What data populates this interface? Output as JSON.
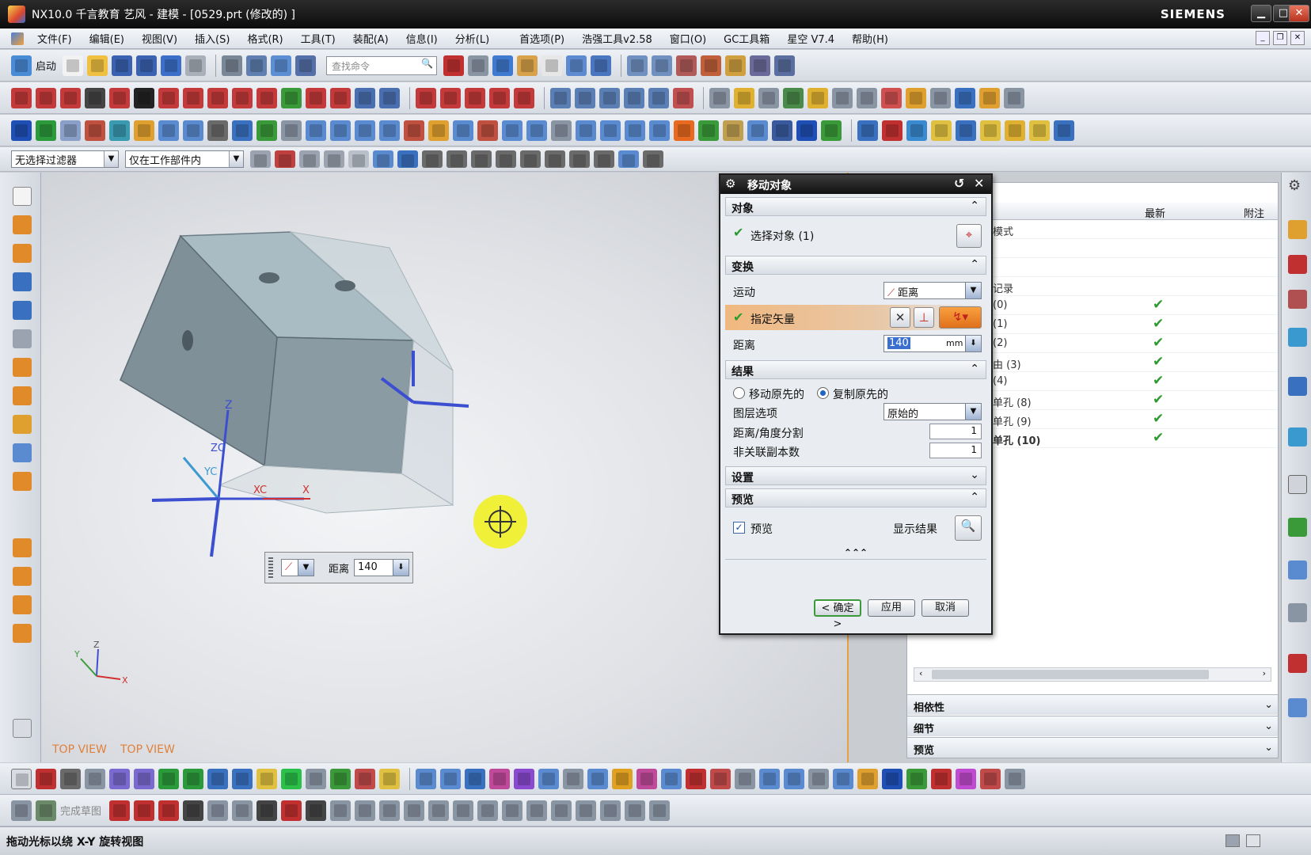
{
  "window": {
    "title": "NX10.0 千言教育 艺风 - 建模 - [0529.prt (修改的) ]",
    "brand": "SIEMENS",
    "min_label": "▁",
    "max_label": "□",
    "close_label": "✕"
  },
  "menu": {
    "items": [
      "文件(F)",
      "编辑(E)",
      "视图(V)",
      "插入(S)",
      "格式(R)",
      "工具(T)",
      "装配(A)",
      "信息(I)",
      "分析(L)",
      "首选项(P)",
      "浩强工具v2.58",
      "窗口(O)",
      "GC工具箱",
      "星空 V7.4",
      "帮助(H)"
    ]
  },
  "toolbar": {
    "start_label": "启动",
    "search_placeholder": "查找命令",
    "filter_select": "无选择过滤器",
    "scope_select": "仅在工作部件内"
  },
  "viewport": {
    "view_label_1": "TOP VIEW",
    "view_label_2": "TOP VIEW",
    "axes": {
      "z": "Z",
      "zc": "ZC",
      "yc": "YC",
      "xc": "XC",
      "x": "X"
    },
    "mini_axes": {
      "z": "Z",
      "x": "X",
      "y": "Y"
    },
    "dynamic_input": {
      "label": "距离",
      "value": "140"
    }
  },
  "dialog": {
    "title": "移动对象",
    "groups": {
      "object": "对象",
      "transform": "变换",
      "result": "结果",
      "settings": "设置",
      "preview": "预览"
    },
    "select_object": "选择对象 (1)",
    "motion_label": "运动",
    "motion_value": "距离",
    "vector_label": "指定矢量",
    "distance_label": "距离",
    "distance_value": "140",
    "distance_unit": "mm",
    "move_original": "移动原先的",
    "copy_original": "复制原先的",
    "layer_label": "图层选项",
    "layer_value": "原始的",
    "split_label": "距离/角度分割",
    "split_value": "1",
    "copies_label": "非关联副本数",
    "copies_value": "1",
    "preview_check": "预览",
    "show_result": "显示结果",
    "more": "⌃⌃⌃",
    "ok": "< 确定 >",
    "apply": "应用",
    "cancel": "取消"
  },
  "navigator": {
    "col_latest": "最新",
    "col_note": "附注",
    "rows": [
      {
        "label": "模式",
        "check": ""
      },
      {
        "label": "",
        "check": ""
      },
      {
        "label": "",
        "check": ""
      },
      {
        "label": "记录",
        "check": ""
      },
      {
        "label": "(0)",
        "check": "✔"
      },
      {
        "label": "(1)",
        "check": "✔"
      },
      {
        "label": "(2)",
        "check": "✔"
      },
      {
        "label": "由 (3)",
        "check": "✔"
      },
      {
        "label": "(4)",
        "check": "✔"
      },
      {
        "label": "单孔 (8)",
        "check": "✔"
      },
      {
        "label": "单孔 (9)",
        "check": "✔"
      },
      {
        "label": "单孔 (10)",
        "check": "✔"
      }
    ],
    "sections": [
      "相依性",
      "细节",
      "预览"
    ]
  },
  "sketch_toolbar": {
    "finish_sketch": "完成草图"
  },
  "status": {
    "text": "拖动光标以绕 X-Y 旋转视图"
  },
  "colors": {
    "accent_orange": "#e8a040",
    "check_green": "#2c9a30",
    "cursor_yellow": "#f0f028"
  }
}
